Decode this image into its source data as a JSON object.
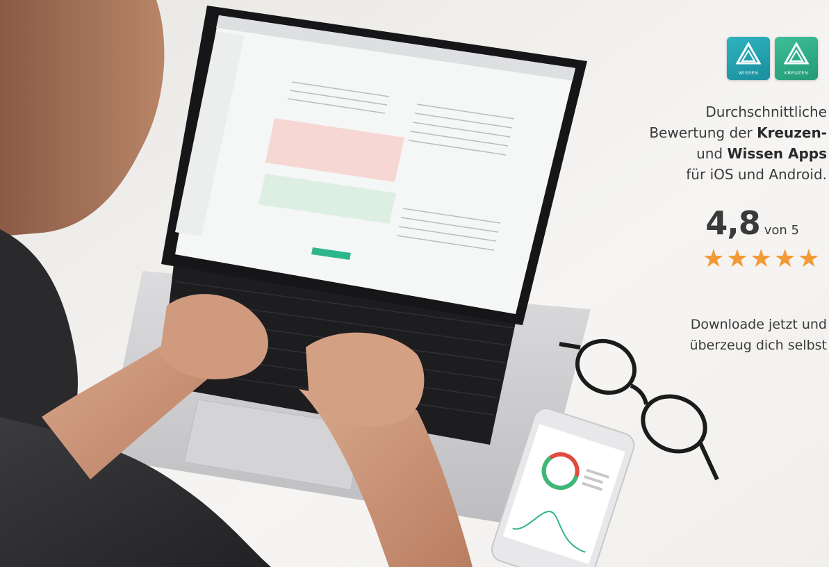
{
  "apps": {
    "wissen": {
      "label": "WISSEN",
      "color": "#23a6b4",
      "icon": "triangle-logo-icon"
    },
    "kreuzen": {
      "label": "KREUZEN",
      "color": "#34b38a",
      "icon": "triangle-logo-icon"
    }
  },
  "rating": {
    "line1": "Durchschnittliche",
    "line2_pre": "Bewertung der ",
    "line2_bold": "Kreuzen-",
    "line3_pre": "und ",
    "line3_bold": "Wissen Apps",
    "line4": "für iOS und Android.",
    "score": "4,8",
    "score_suffix": "von 5",
    "stars": "★★★★★",
    "star_count": 5,
    "star_color": "#f29a38"
  },
  "cta": {
    "line1": "Downloade jetzt und",
    "line2": "überzeug dich selbst"
  }
}
